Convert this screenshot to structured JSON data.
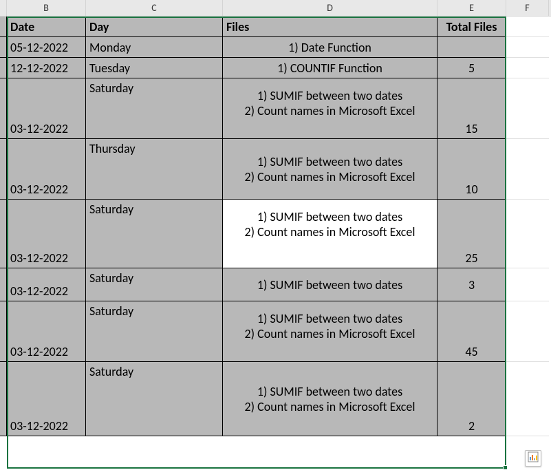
{
  "columns": {
    "B": "B",
    "C": "C",
    "D": "D",
    "E": "E",
    "F": "F"
  },
  "headers": {
    "date": "Date",
    "day": "Day",
    "files": "Files",
    "total": "Total Files"
  },
  "rows": [
    {
      "date": "05-12-2022",
      "day": "Monday",
      "files": "1) Date Function",
      "total": ""
    },
    {
      "date": "12-12-2022",
      "day": "Tuesday",
      "files": "1) COUNTIF Function",
      "total": "5"
    },
    {
      "date": "03-12-2022",
      "day": "Saturday",
      "files": "1) SUMIF between two dates\n2) Count names in Microsoft Excel",
      "total": "15"
    },
    {
      "date": "03-12-2022",
      "day": "Thursday",
      "files": "1) SUMIF between two dates\n2) Count names in Microsoft Excel",
      "total": "10"
    },
    {
      "date": "03-12-2022",
      "day": "Saturday",
      "files": "1) SUMIF between two dates\n2) Count names in Microsoft Excel",
      "total": "25"
    },
    {
      "date": "03-12-2022",
      "day": "Saturday",
      "files": "1) SUMIF between two dates",
      "total": "3"
    },
    {
      "date": "03-12-2022",
      "day": "Saturday",
      "files": "1) SUMIF between two dates\n2) Count names in Microsoft Excel",
      "total": "45"
    },
    {
      "date": "03-12-2022",
      "day": "Saturday",
      "files": "1) SUMIF between two dates\n2) Count names in Microsoft Excel",
      "total": "2"
    }
  ],
  "chart_data": {
    "type": "table",
    "columns": [
      "Date",
      "Day",
      "Files",
      "Total Files"
    ],
    "rows": [
      [
        "05-12-2022",
        "Monday",
        "1) Date Function",
        null
      ],
      [
        "12-12-2022",
        "Tuesday",
        "1) COUNTIF Function",
        5
      ],
      [
        "03-12-2022",
        "Saturday",
        "1) SUMIF between two dates\n2) Count names in Microsoft Excel",
        15
      ],
      [
        "03-12-2022",
        "Thursday",
        "1) SUMIF between two dates\n2) Count names in Microsoft Excel",
        10
      ],
      [
        "03-12-2022",
        "Saturday",
        "1) SUMIF between two dates\n2) Count names in Microsoft Excel",
        25
      ],
      [
        "03-12-2022",
        "Saturday",
        "1) SUMIF between two dates",
        3
      ],
      [
        "03-12-2022",
        "Saturday",
        "1) SUMIF between two dates\n2) Count names in Microsoft Excel",
        45
      ],
      [
        "03-12-2022",
        "Saturday",
        "1) SUMIF between two dates\n2) Count names in Microsoft Excel",
        2
      ]
    ]
  }
}
